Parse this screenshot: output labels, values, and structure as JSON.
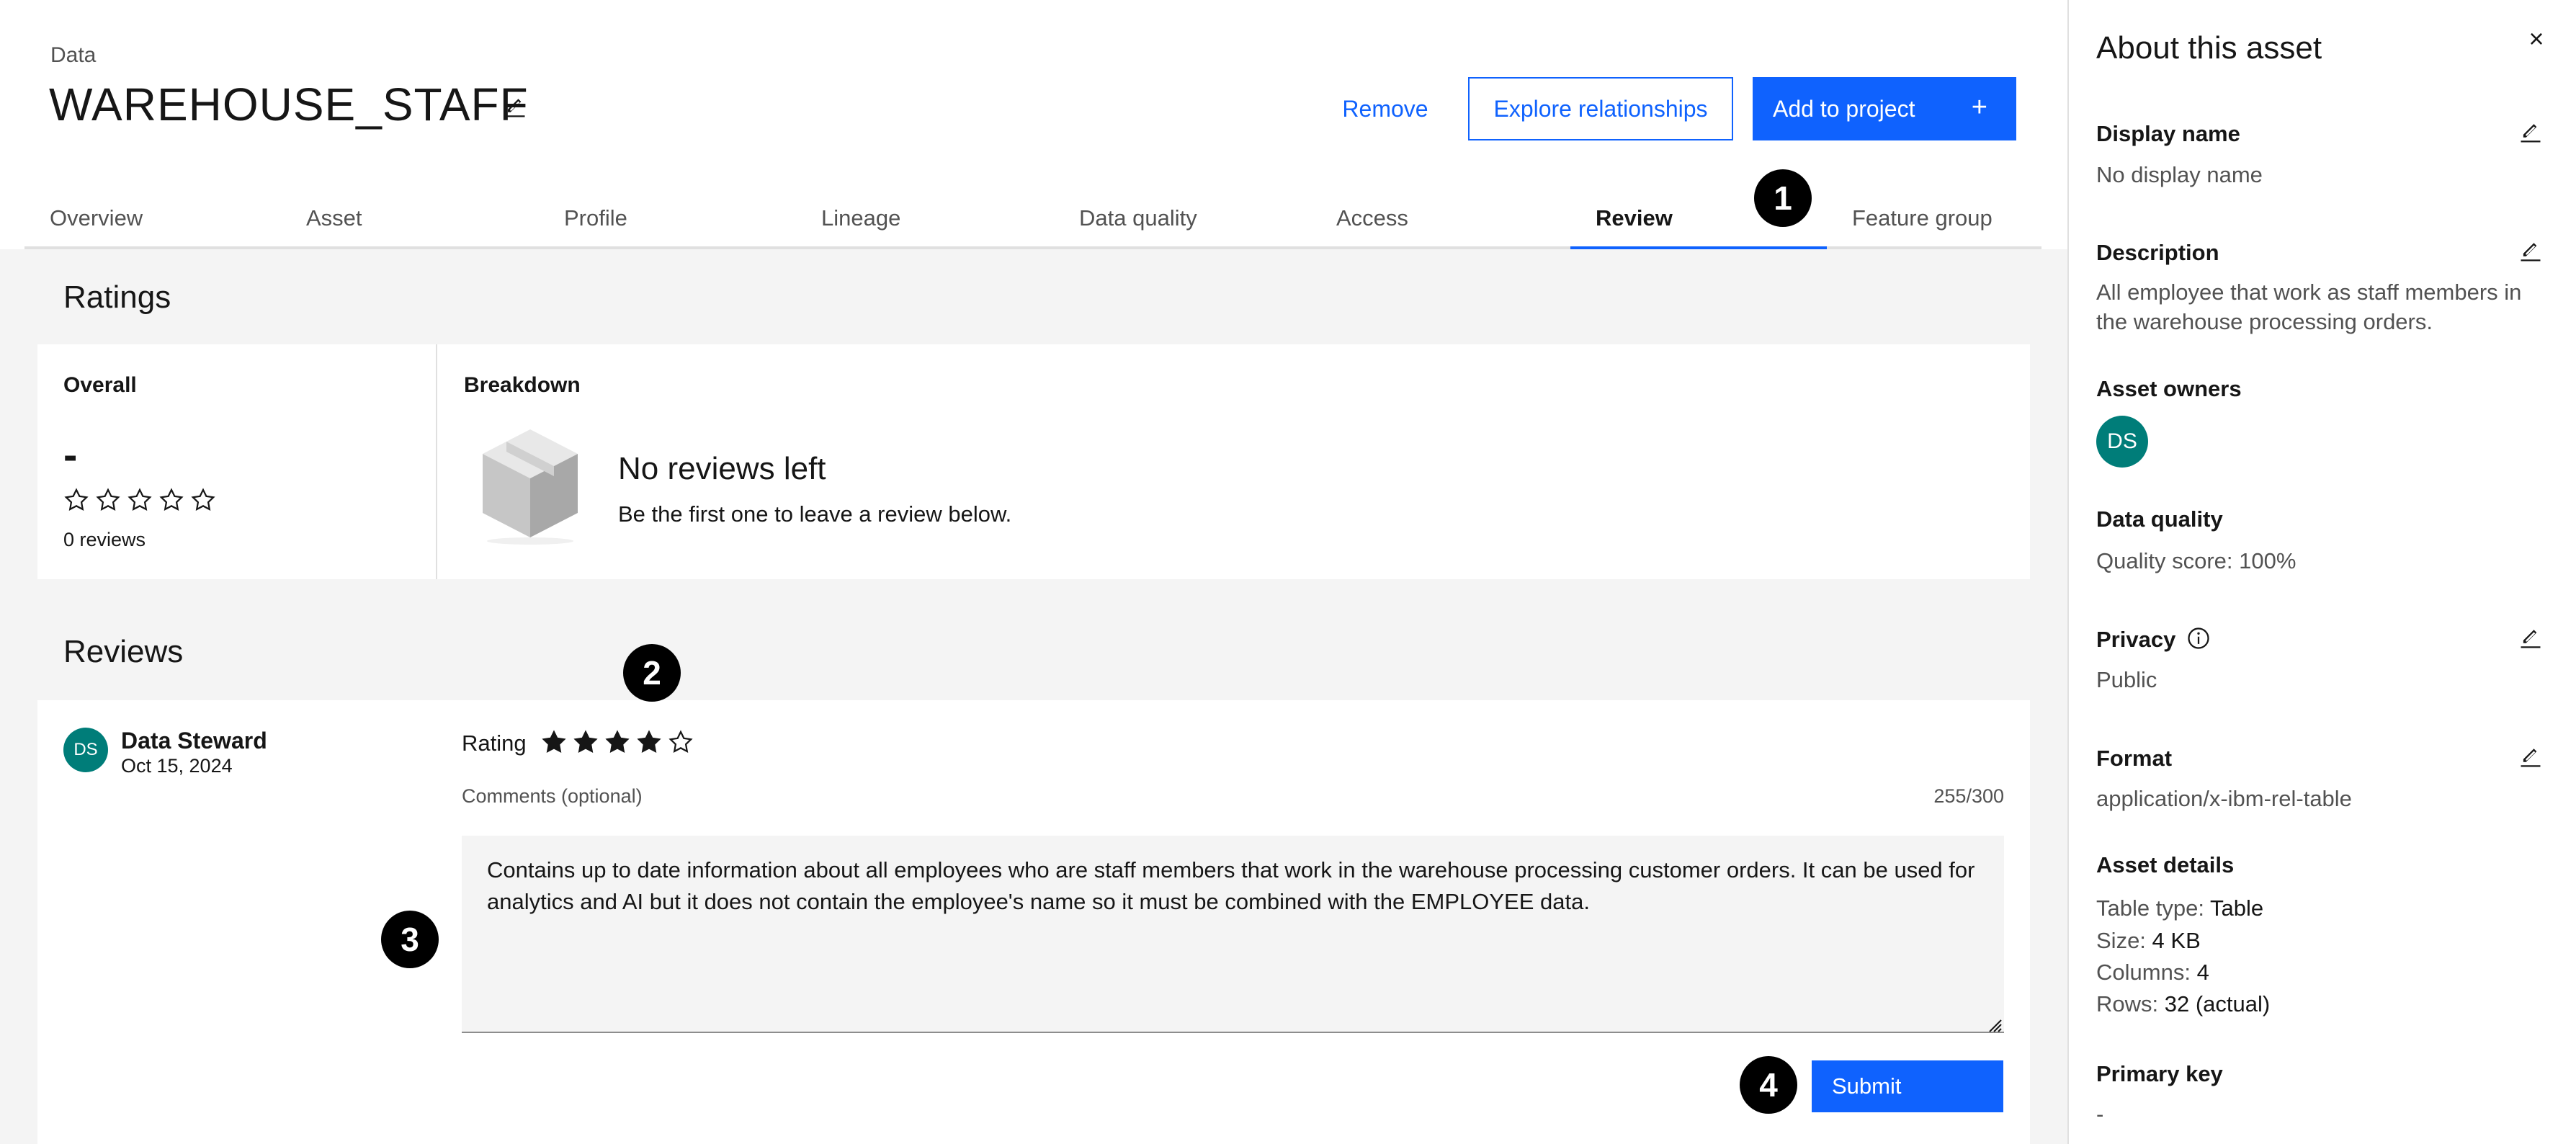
{
  "header": {
    "breadcrumb": "Data",
    "title": "WAREHOUSE_STAFF",
    "remove_label": "Remove",
    "explore_label": "Explore relationships",
    "add_label": "Add to project",
    "add_icon": "plus-icon"
  },
  "tabs": [
    {
      "label": "Overview",
      "active": false
    },
    {
      "label": "Asset",
      "active": false
    },
    {
      "label": "Profile",
      "active": false
    },
    {
      "label": "Lineage",
      "active": false
    },
    {
      "label": "Data quality",
      "active": false
    },
    {
      "label": "Access",
      "active": false
    },
    {
      "label": "Review",
      "active": true
    },
    {
      "label": "Feature group",
      "active": false
    }
  ],
  "callouts": [
    "1",
    "2",
    "3",
    "4"
  ],
  "ratings": {
    "heading": "Ratings",
    "overall_label": "Overall",
    "overall_value": "-",
    "overall_stars": 0,
    "review_count": "0 reviews",
    "breakdown_label": "Breakdown",
    "empty_title": "No reviews left",
    "empty_subtitle": "Be the first one to leave a review below."
  },
  "reviews": {
    "heading": "Reviews",
    "reviewer_initials": "DS",
    "reviewer_name": "Data Steward",
    "review_date": "Oct 15, 2024",
    "rating_label": "Rating",
    "rating_value": 4,
    "rating_max": 5,
    "comments_label": "Comments (optional)",
    "char_count": "255/300",
    "comment_text": "Contains up to date information about all employees who are staff members that work in the warehouse processing customer orders. It can be used for analytics and AI but it does not contain the employee's name so it must be combined with the EMPLOYEE data.",
    "submit_label": "Submit"
  },
  "panel": {
    "title": "About this asset",
    "close_icon": "close-icon",
    "display_name_label": "Display name",
    "display_name_value": "No display name",
    "description_label": "Description",
    "description_value": "All employee that work as staff members in the warehouse processing orders.",
    "owners_label": "Asset owners",
    "owner_initials": "DS",
    "dq_label": "Data quality",
    "dq_value": "Quality score: 100%",
    "privacy_label": "Privacy",
    "privacy_value": "Public",
    "format_label": "Format",
    "format_value": "application/x-ibm-rel-table",
    "details_label": "Asset details",
    "details": [
      {
        "key": "Table type:",
        "value": "Table"
      },
      {
        "key": "Size:",
        "value": "4 KB"
      },
      {
        "key": "Columns:",
        "value": "4"
      },
      {
        "key": "Rows:",
        "value": "32 (actual)"
      }
    ],
    "primary_key_label": "Primary key",
    "primary_key_value": "-"
  },
  "colors": {
    "primary": "#0f62fe",
    "avatar": "#007d79",
    "background": "#f4f4f4"
  }
}
